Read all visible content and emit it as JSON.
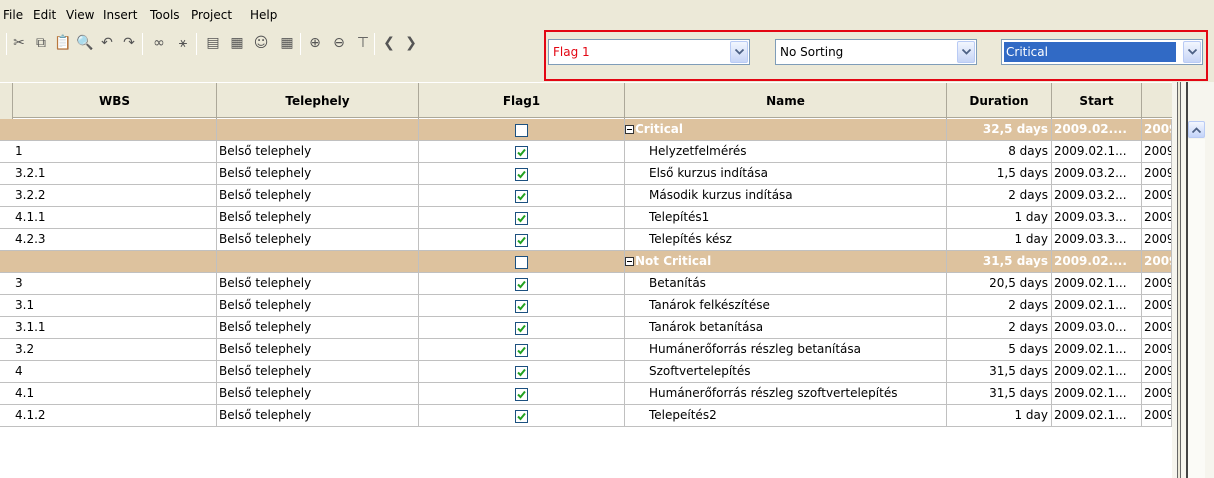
{
  "menu": [
    "File",
    "Edit",
    "View",
    "Insert",
    "Tools",
    "Project",
    "Help"
  ],
  "toolbar": {
    "icons": [
      {
        "name": "cut-icon",
        "glyph": "✂"
      },
      {
        "name": "copy-icon",
        "glyph": "⧉"
      },
      {
        "name": "paste-icon",
        "glyph": "📋"
      },
      {
        "name": "find-icon",
        "glyph": "🔍"
      },
      {
        "name": "undo-icon",
        "glyph": "↶"
      },
      {
        "name": "redo-icon",
        "glyph": "↷"
      },
      {
        "name": "link-icon",
        "glyph": "∞"
      },
      {
        "name": "unlink-icon",
        "glyph": "⚹"
      },
      {
        "name": "notes-icon",
        "glyph": "▤"
      },
      {
        "name": "information-icon",
        "glyph": "▦"
      },
      {
        "name": "resource-icon",
        "glyph": "☺"
      },
      {
        "name": "gantt-table-icon",
        "glyph": "▦"
      },
      {
        "name": "zoom-in-icon",
        "glyph": "⊕"
      },
      {
        "name": "zoom-out-icon",
        "glyph": "⊖"
      },
      {
        "name": "filter-icon",
        "glyph": "⊤"
      },
      {
        "name": "scroll-left-icon",
        "glyph": "❮"
      },
      {
        "name": "scroll-right-icon",
        "glyph": "❯"
      }
    ],
    "flag_combo": "Flag 1",
    "sort_combo": "No Sorting",
    "group_combo": "Critical"
  },
  "columns": [
    "WBS",
    "Telephely",
    "Flag1",
    "Name",
    "Duration",
    "Start"
  ],
  "groups": [
    {
      "label": "Critical",
      "duration": "32,5 days",
      "start": "2009.02....",
      "finish": "2009",
      "rows": [
        {
          "wbs": "1",
          "telephely": "Belső telephely",
          "flag": true,
          "name": "Helyzetfelmérés",
          "duration": "8 days",
          "start": "2009.02.1...",
          "finish": "2009"
        },
        {
          "wbs": "3.2.1",
          "telephely": "Belső telephely",
          "flag": true,
          "name": "Első kurzus indítása",
          "duration": "1,5 days",
          "start": "2009.03.2...",
          "finish": "2009"
        },
        {
          "wbs": "3.2.2",
          "telephely": "Belső telephely",
          "flag": true,
          "name": "Második kurzus indítása",
          "duration": "2 days",
          "start": "2009.03.2...",
          "finish": "2009"
        },
        {
          "wbs": "4.1.1",
          "telephely": "Belső telephely",
          "flag": true,
          "name": "Telepítés1",
          "duration": "1 day",
          "start": "2009.03.3...",
          "finish": "2009"
        },
        {
          "wbs": "4.2.3",
          "telephely": "Belső telephely",
          "flag": true,
          "name": "Telepítés kész",
          "duration": "1 day",
          "start": "2009.03.3...",
          "finish": "2009"
        }
      ]
    },
    {
      "label": "Not Critical",
      "duration": "31,5 days",
      "start": "2009.02....",
      "finish": "2009",
      "rows": [
        {
          "wbs": "3",
          "telephely": "Belső telephely",
          "flag": true,
          "name": "Betanítás",
          "duration": "20,5 days",
          "start": "2009.02.1...",
          "finish": "2009"
        },
        {
          "wbs": "3.1",
          "telephely": "Belső telephely",
          "flag": true,
          "name": "Tanárok felkészítése",
          "duration": "2 days",
          "start": "2009.02.1...",
          "finish": "2009"
        },
        {
          "wbs": "3.1.1",
          "telephely": "Belső telephely",
          "flag": true,
          "name": "Tanárok betanítása",
          "duration": "2 days",
          "start": "2009.03.0...",
          "finish": "2009"
        },
        {
          "wbs": "3.2",
          "telephely": "Belső telephely",
          "flag": true,
          "name": "Humánerőforrás részleg betanítása",
          "duration": "5 days",
          "start": "2009.02.1...",
          "finish": "2009"
        },
        {
          "wbs": "4",
          "telephely": "Belső telephely",
          "flag": true,
          "name": "Szoftvertelepítés",
          "duration": "31,5 days",
          "start": "2009.02.1...",
          "finish": "2009"
        },
        {
          "wbs": "4.1",
          "telephely": "Belső telephely",
          "flag": true,
          "name": "Humánerőforrás részleg szoftvertelepítés",
          "duration": "31,5 days",
          "start": "2009.02.1...",
          "finish": "2009"
        },
        {
          "wbs": "4.1.2",
          "telephely": "Belső telephely",
          "flag": true,
          "name": "Telepeítés2",
          "duration": "1 day",
          "start": "2009.02.1...",
          "finish": "2009"
        }
      ]
    }
  ],
  "colors": {
    "group_row": "#ddc29e",
    "highlight_border": "#e30613",
    "flag_combo_text": "#e30613",
    "selected_combo_bg": "#316ac5",
    "check": "#21a121"
  }
}
